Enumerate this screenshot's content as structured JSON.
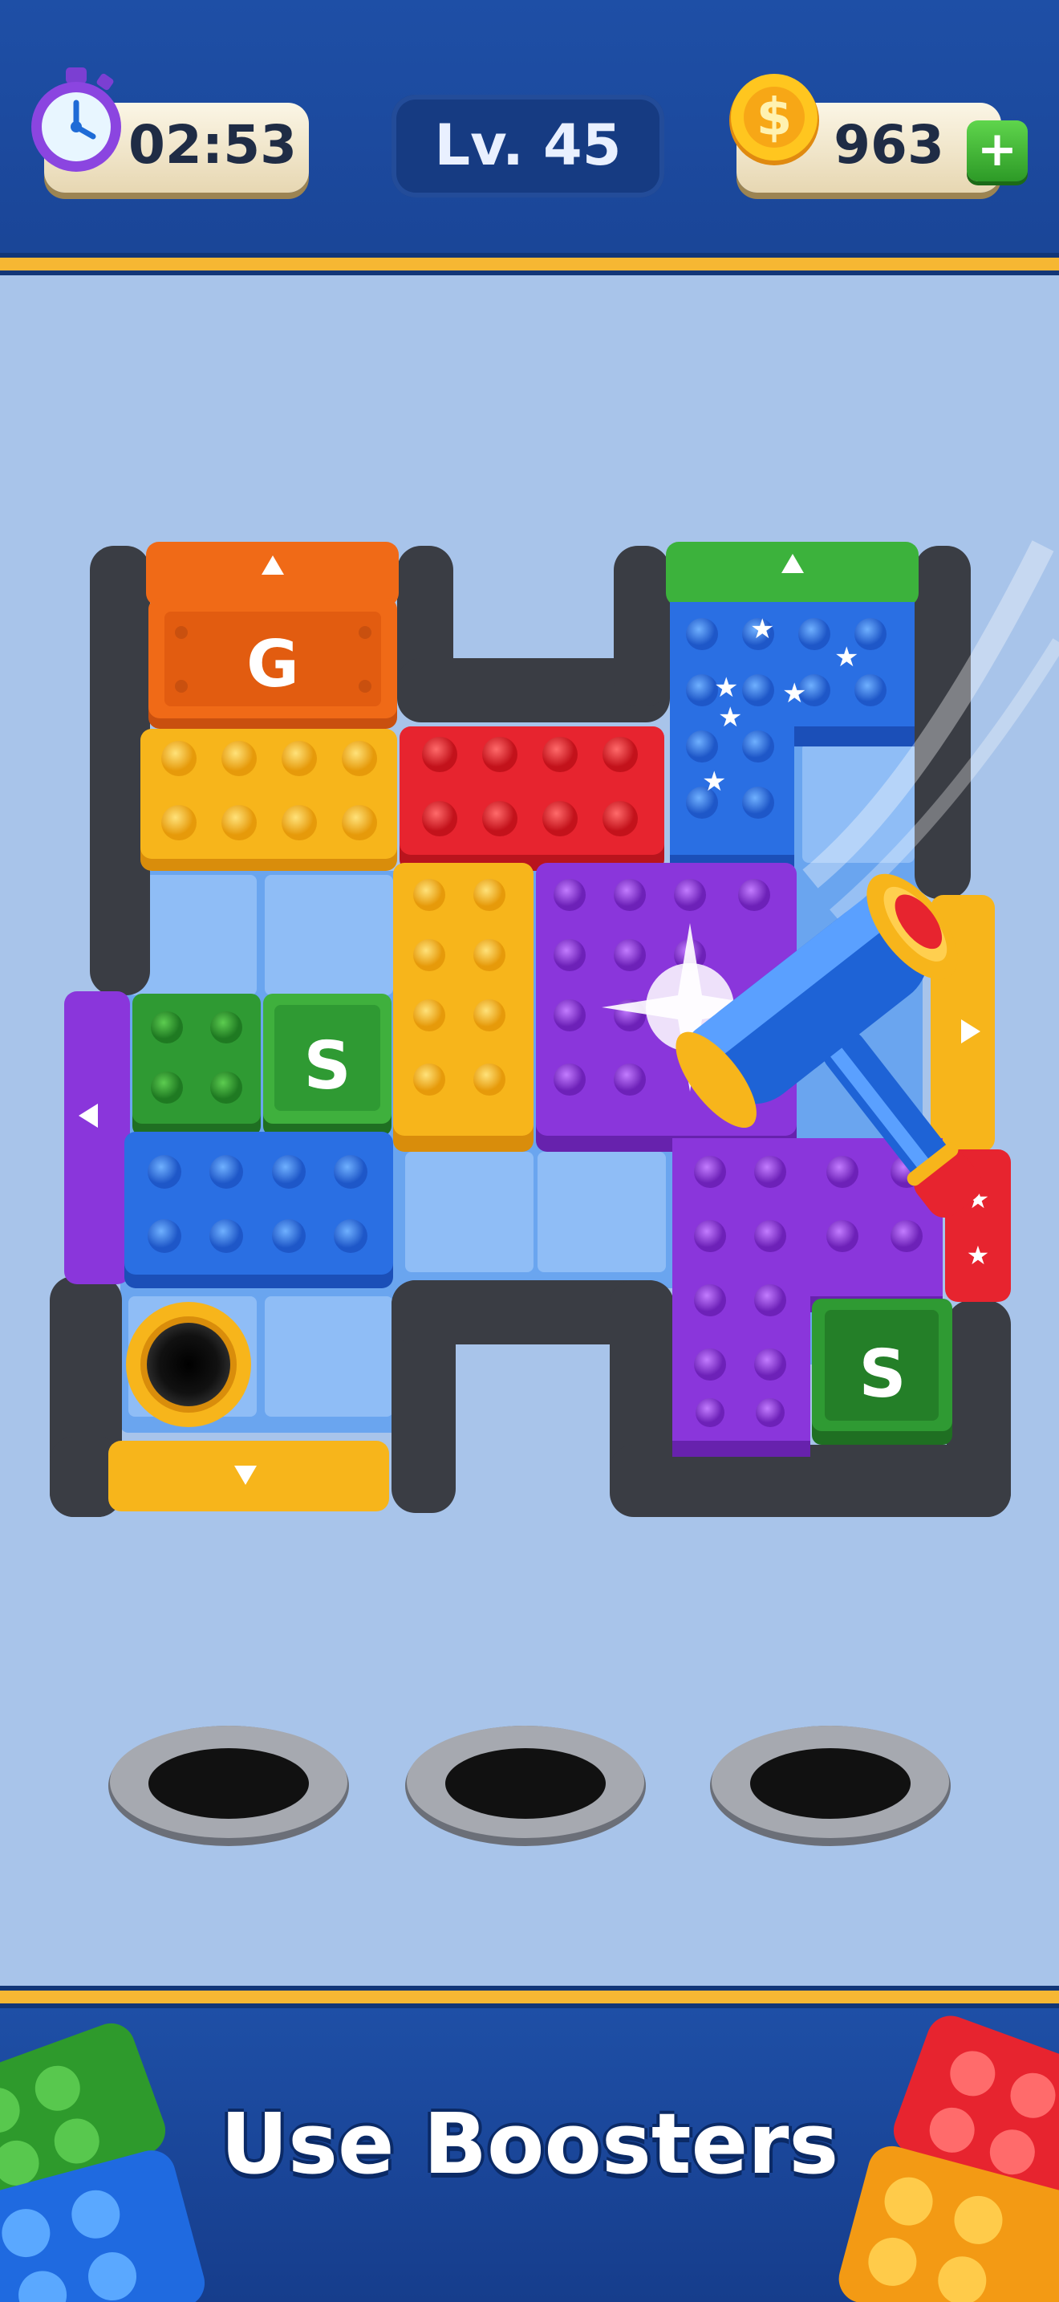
{
  "hud": {
    "timer": "02:53",
    "level": "Lv. 45",
    "coins": "963",
    "plus": "+"
  },
  "board": {
    "letters": [
      "G",
      "S",
      "S"
    ]
  },
  "banner": "Use Boosters",
  "colors": {
    "orange": "#f06a17",
    "yellow": "#f7b51b",
    "red": "#e7242f",
    "blue": "#2a6fe3",
    "purple": "#8a36db",
    "green": "#2f9a33",
    "dark": "#3a3d44"
  },
  "icons": [
    "stopwatch-icon",
    "coin-icon",
    "hammer-icon",
    "arrow-up-icon",
    "arrow-left-icon",
    "arrow-right-icon",
    "arrow-down-icon"
  ]
}
